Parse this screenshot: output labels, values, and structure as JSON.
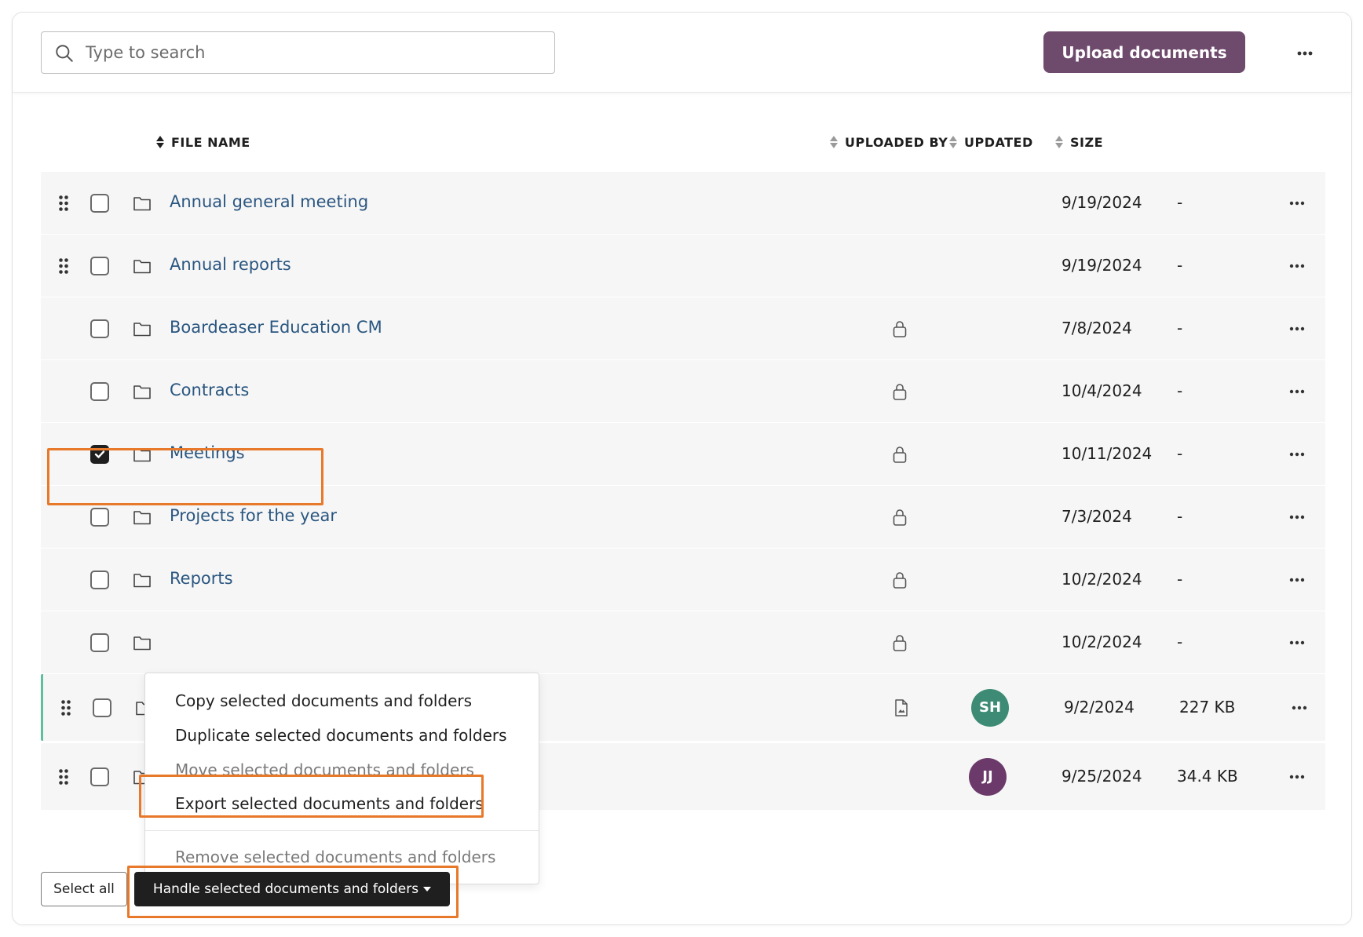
{
  "toolbar": {
    "search_placeholder": "Type to search",
    "search_value": "",
    "upload_label": "Upload documents",
    "accent_color": "#6e4a6c"
  },
  "table": {
    "headers": {
      "file_name": "FILE NAME",
      "uploaded_by": "UPLOADED BY",
      "updated": "UPDATED",
      "size": "SIZE"
    },
    "rows": [
      {
        "name": "Annual general meeting",
        "uploaded_by": "",
        "updated": "9/19/2024",
        "size": "-",
        "draggable": true,
        "locked": false,
        "checked": false
      },
      {
        "name": "Annual reports",
        "uploaded_by": "",
        "updated": "9/19/2024",
        "size": "-",
        "draggable": true,
        "locked": false,
        "checked": false
      },
      {
        "name": "Boardeaser Education CM",
        "uploaded_by": "",
        "updated": "7/8/2024",
        "size": "-",
        "draggable": false,
        "locked": true,
        "checked": false
      },
      {
        "name": "Contracts",
        "uploaded_by": "",
        "updated": "10/4/2024",
        "size": "-",
        "draggable": false,
        "locked": true,
        "checked": false
      },
      {
        "name": "Meetings",
        "uploaded_by": "",
        "updated": "10/11/2024",
        "size": "-",
        "draggable": false,
        "locked": true,
        "checked": true
      },
      {
        "name": "Projects for the year",
        "uploaded_by": "",
        "updated": "7/3/2024",
        "size": "-",
        "draggable": false,
        "locked": true,
        "checked": false
      },
      {
        "name": "Reports",
        "uploaded_by": "",
        "updated": "10/2/2024",
        "size": "-",
        "draggable": false,
        "locked": true,
        "checked": false
      },
      {
        "name": "",
        "uploaded_by": "",
        "updated": "10/2/2024",
        "size": "-",
        "draggable": false,
        "locked": true,
        "checked": false
      },
      {
        "name": "",
        "uploaded_by": "SH",
        "avatar_color": "#3d8b74",
        "updated": "9/2/2024",
        "size": "227 KB",
        "draggable": true,
        "locked": false,
        "file": true,
        "checked": false
      },
      {
        "name": "",
        "uploaded_by": "JJ",
        "avatar_color": "#6b3a6a",
        "updated": "9/25/2024",
        "size": "34.4 KB",
        "draggable": true,
        "locked": false,
        "checked": false
      }
    ]
  },
  "dropdown": {
    "items": [
      {
        "label": "Copy selected documents and folders",
        "disabled": false
      },
      {
        "label": "Duplicate selected documents and folders",
        "disabled": false
      },
      {
        "label": "Move selected documents and folders",
        "disabled": true
      },
      {
        "label": "Export selected documents and folders",
        "disabled": false
      },
      {
        "label": "Remove selected documents and folders",
        "disabled": true
      }
    ]
  },
  "footer": {
    "select_all_label": "Select all",
    "handle_label": "Handle selected documents and folders"
  },
  "highlight_color": "#e8782a"
}
